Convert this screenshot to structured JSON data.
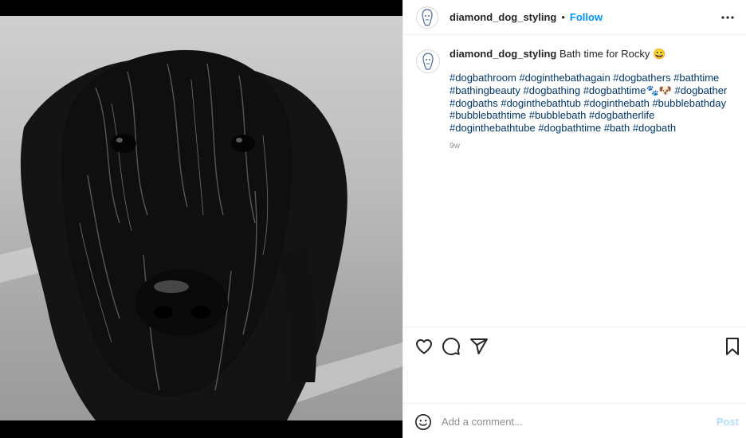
{
  "post": {
    "username": "diamond_dog_styling",
    "separator": "•",
    "follow_label": "Follow",
    "caption_text": "Bath time for Rocky 😀",
    "hashtags": "#dogbathroom #doginthebathagain #dogbathers #bathtime #bathingbeauty #dogbathing #dogbathtime🐾🐶 #dogbather #dogbaths #doginthebathtub #doginthebath #bubblebathday #bubblebathtime #bubblebath #dogbatherlife #doginthebathtube #dogbathtime #bath #dogbath",
    "age": "9w"
  },
  "comment": {
    "placeholder": "Add a comment...",
    "post_label": "Post"
  },
  "icons": {
    "more": "more-options-icon",
    "like": "heart-icon",
    "comment": "comment-icon",
    "share": "paper-plane-icon",
    "save": "bookmark-icon",
    "emoji": "emoji-icon"
  },
  "colors": {
    "link": "#0095f6",
    "hashtag": "#00376b",
    "muted": "#8e8e8e",
    "post_disabled": "#b2dffc"
  }
}
